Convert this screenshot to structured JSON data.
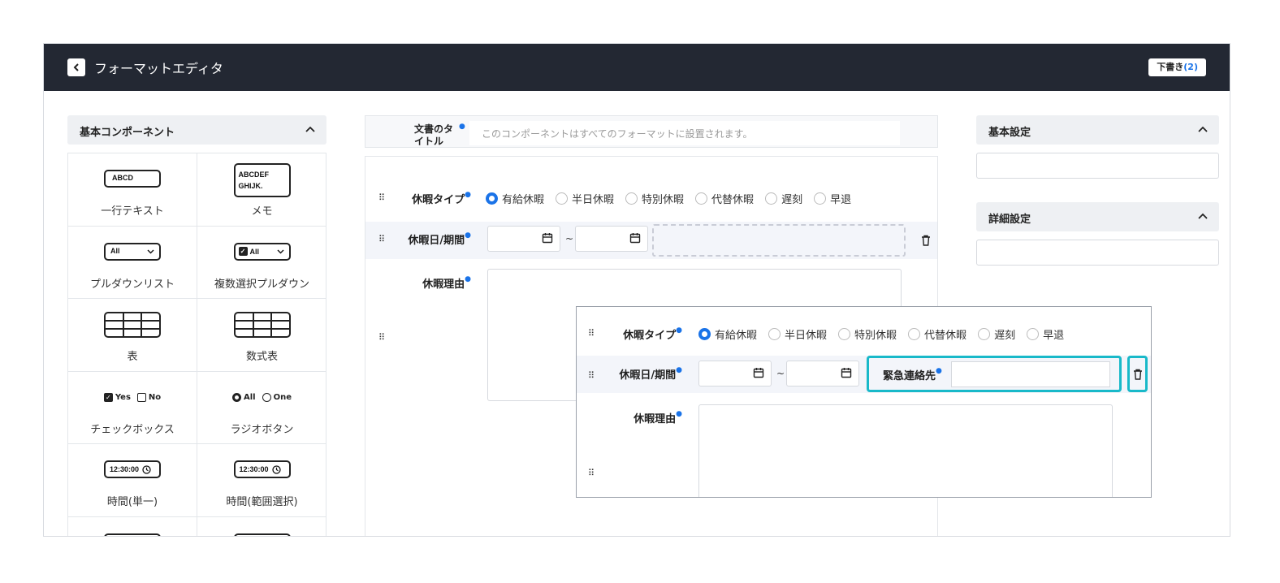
{
  "header": {
    "title": "フォーマットエディタ",
    "draft_label": "下書き",
    "draft_count": "(2)"
  },
  "palette": {
    "title": "基本コンポーネント",
    "items": [
      {
        "label": "一行テキスト",
        "icon": "ABCD"
      },
      {
        "label": "メモ",
        "icon": "ABCDEF GHIJK."
      },
      {
        "label": "プルダウンリスト",
        "icon": "All"
      },
      {
        "label": "複数選択プルダウン",
        "icon": "All"
      },
      {
        "label": "表",
        "icon": "table-icon"
      },
      {
        "label": "数式表",
        "icon": "table-icon"
      },
      {
        "label": "チェックボックス",
        "icon_yes": "Yes",
        "icon_no": "No"
      },
      {
        "label": "ラジオボタン",
        "icon_all": "All",
        "icon_one": "One"
      },
      {
        "label": "時間(単一)",
        "icon": "12:30:00"
      },
      {
        "label": "時間(範囲選択)",
        "icon": "12:30:00"
      }
    ]
  },
  "form": {
    "doc_title_label": "文書のタイトル",
    "doc_title_placeholder": "このコンポーネントはすべてのフォーマットに設置されます。",
    "leave_type_label": "休暇タイプ",
    "leave_type_options": [
      "有給休暇",
      "半日休暇",
      "特別休暇",
      "代替休暇",
      "遅刻",
      "早退"
    ],
    "leave_type_selected": "有給休暇",
    "leave_date_label": "休暇日/期間",
    "date_separator": "~",
    "reason_label": "休暇理由"
  },
  "overlay": {
    "leave_type_label": "休暇タイプ",
    "leave_type_options": [
      "有給休暇",
      "半日休暇",
      "特別休暇",
      "代替休暇",
      "遅刻",
      "早退"
    ],
    "leave_date_label": "休暇日/期間",
    "date_separator": "~",
    "contact_label": "緊急連絡先",
    "reason_label": "休暇理由"
  },
  "settings": {
    "basic_title": "基本設定",
    "detail_title": "詳細設定"
  },
  "colors": {
    "topbar": "#232833",
    "accent": "#1a73e8",
    "highlight": "#19b9c9"
  }
}
